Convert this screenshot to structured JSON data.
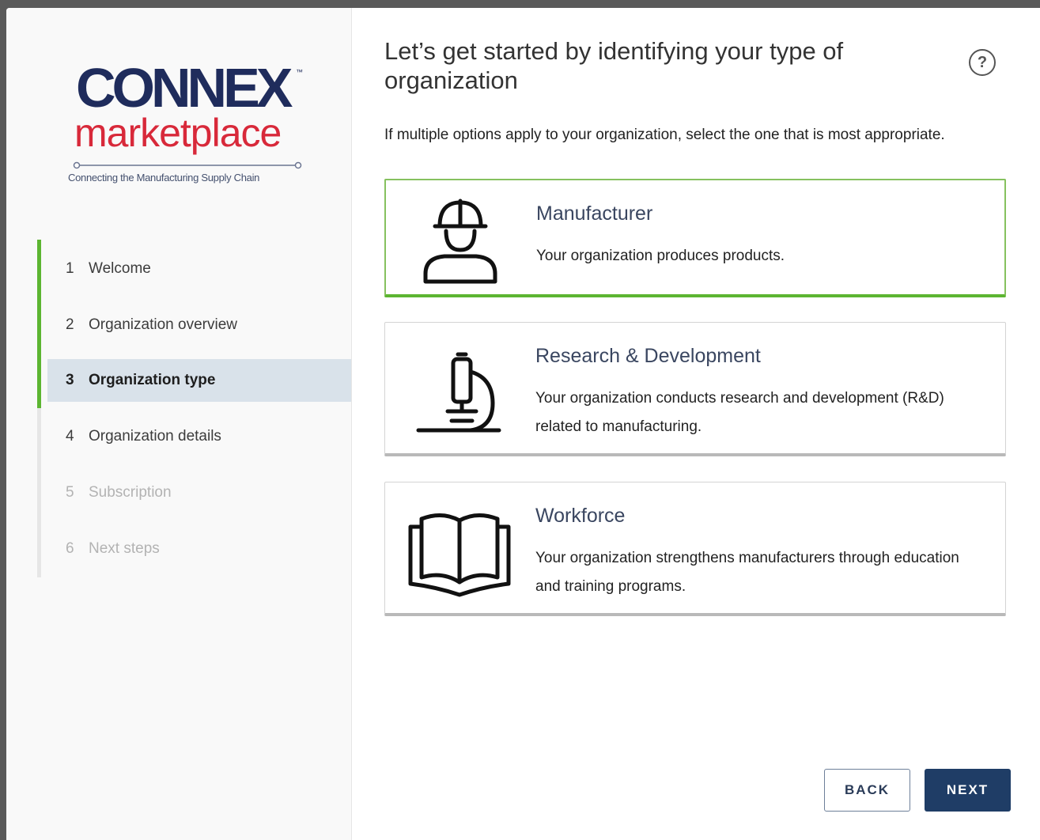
{
  "logo": {
    "brand": "CONNEX",
    "trademark": "™",
    "product": "marketplace",
    "tagline": "Connecting the Manufacturing Supply Chain"
  },
  "steps": [
    {
      "num": "1",
      "label": "Welcome",
      "state": "completed"
    },
    {
      "num": "2",
      "label": "Organization overview",
      "state": "completed"
    },
    {
      "num": "3",
      "label": "Organization type",
      "state": "active"
    },
    {
      "num": "4",
      "label": "Organization details",
      "state": "pending"
    },
    {
      "num": "5",
      "label": "Subscription",
      "state": "disabled"
    },
    {
      "num": "6",
      "label": "Next steps",
      "state": "disabled"
    }
  ],
  "main": {
    "title": "Let’s get started by identifying your type of organization",
    "help_symbol": "?",
    "subtitle": "If multiple options apply to your organization, select the one that is most appropriate."
  },
  "options": [
    {
      "title": "Manufacturer",
      "description": "Your organization produces products.",
      "icon": "worker-hardhat-icon",
      "selected": true
    },
    {
      "title": "Research & Development",
      "description": "Your organization conducts research and development (R&D) related to manufacturing.",
      "icon": "microscope-icon",
      "selected": false
    },
    {
      "title": "Workforce",
      "description": "Your organization strengthens manufacturers through education and training programs.",
      "icon": "open-book-icon",
      "selected": false
    }
  ],
  "buttons": {
    "back": "BACK",
    "next": "NEXT"
  },
  "colors": {
    "progress_green": "#5cb531",
    "brand_navy": "#1f2c5c",
    "brand_red": "#d8293a",
    "primary_button": "#1f3d66",
    "active_step_bg": "#d9e2ea"
  }
}
